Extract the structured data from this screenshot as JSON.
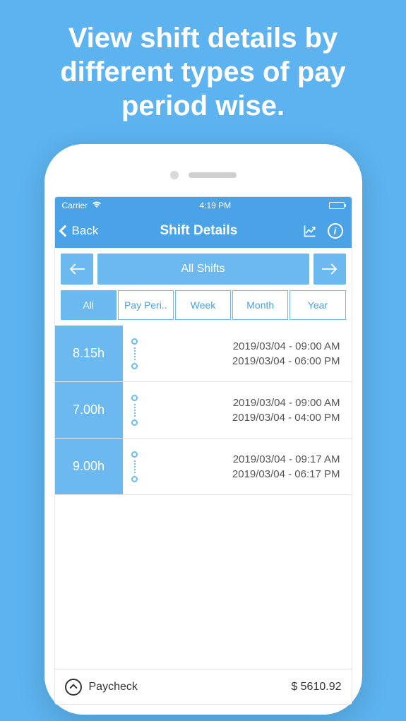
{
  "promo": "View shift details by different types of pay period wise.",
  "statusBar": {
    "carrier": "Carrier",
    "time": "4:19 PM"
  },
  "nav": {
    "back": "Back",
    "title": "Shift Details"
  },
  "filter": {
    "label": "All Shifts"
  },
  "tabs": [
    "All",
    "Pay Peri..",
    "Week",
    "Month",
    "Year"
  ],
  "activeTab": 0,
  "shifts": [
    {
      "hours": "8.15h",
      "start": "2019/03/04 - 09:00 AM",
      "end": "2019/03/04 - 06:00 PM"
    },
    {
      "hours": "7.00h",
      "start": "2019/03/04 - 09:00 AM",
      "end": "2019/03/04 - 04:00 PM"
    },
    {
      "hours": "9.00h",
      "start": "2019/03/04 - 09:17 AM",
      "end": "2019/03/04 - 06:17 PM"
    }
  ],
  "footer": {
    "label": "Paycheck",
    "amount": "$ 5610.92"
  }
}
